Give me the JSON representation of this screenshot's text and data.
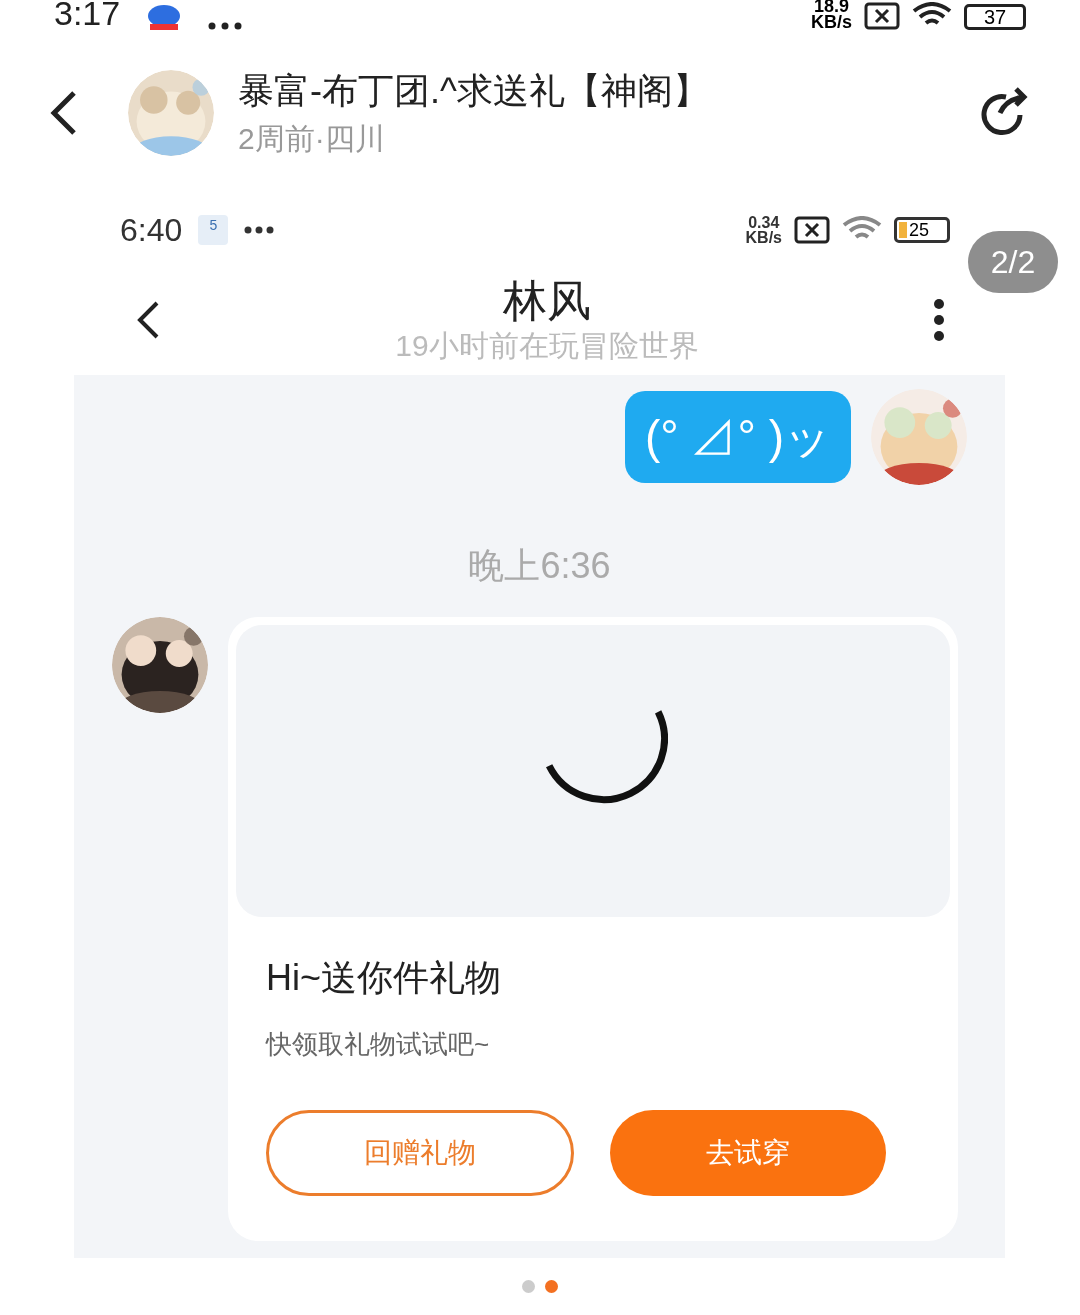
{
  "status_bar": {
    "time": "3:17",
    "speed_value": "18.9",
    "speed_unit": "KB/s",
    "battery": "37"
  },
  "header": {
    "title": "暴富-布丁团.^求送礼【神阁】",
    "subtitle": "2周前·四川"
  },
  "page_indicator": "2/2",
  "screenshot": {
    "status_bar": {
      "time": "6:40",
      "notification_count": "5",
      "speed_value": "0.34",
      "speed_unit": "KB/s",
      "battery": "25"
    },
    "chat_header": {
      "title": "林风",
      "status": "19小时前在玩冒险世界"
    },
    "messages": [
      {
        "kind": "text",
        "text": "(° ⊿° )ッ"
      },
      {
        "kind": "time",
        "text": "晚上6:36"
      },
      {
        "kind": "gift",
        "title": "Hi~送你件礼物",
        "subtitle": "快领取礼物试试吧~",
        "buttons": [
          {
            "label": "回赠礼物",
            "kind": "outline"
          },
          {
            "label": "去试穿",
            "kind": "filled"
          }
        ]
      }
    ]
  },
  "pager_dots": [
    {
      "selected": false
    },
    {
      "selected": true
    }
  ]
}
